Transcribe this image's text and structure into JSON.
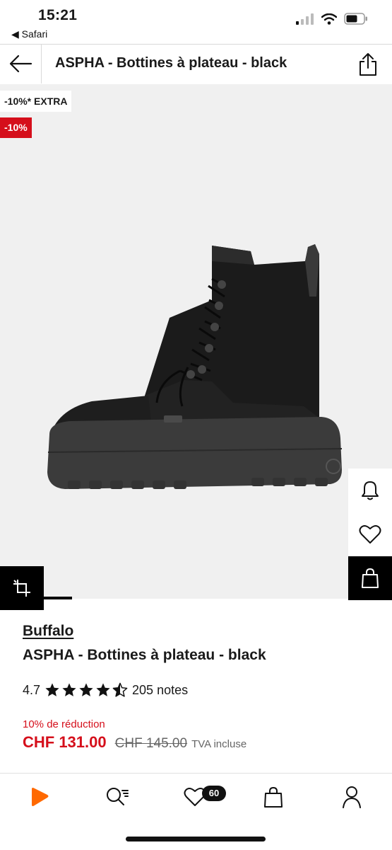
{
  "status_bar": {
    "time": "15:21",
    "back_app": "◀ Safari"
  },
  "header": {
    "title": "ASPHA - Bottines à plateau - black",
    "back_icon": "arrow-left-icon",
    "share_icon": "share-icon"
  },
  "product_image": {
    "badge_extra": "-10%* EXTRA",
    "badge_discount": "-10%",
    "badge_discount_color": "#d50f1b",
    "actions": [
      "bell-icon",
      "heart-icon",
      "shopping-bag-icon"
    ],
    "crop_icon": "crop-icon",
    "current_image_index": 1
  },
  "product": {
    "brand": "Buffalo",
    "name": "ASPHA - Bottines à plateau - black",
    "rating": "4.7",
    "rating_value": 4.7,
    "rating_count": "205 notes",
    "discount_text": "10% de réduction",
    "price": "CHF 131.00",
    "old_price": "CHF 145.00",
    "vat_note": "TVA incluse",
    "accent_color": "#d50f1b"
  },
  "bottom_nav": {
    "items": [
      "home-icon",
      "search-icon",
      "wishlist-icon",
      "bag-icon",
      "profile-icon"
    ],
    "wishlist_count": "60",
    "brand_color": "#ff6900"
  }
}
